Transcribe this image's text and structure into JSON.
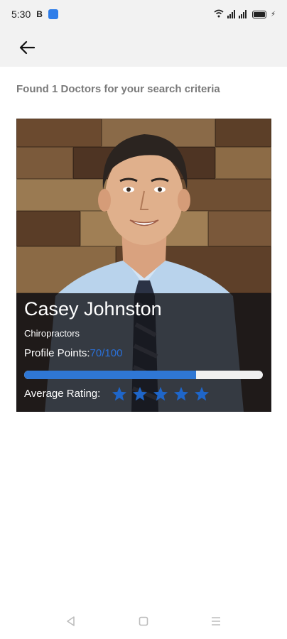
{
  "status_bar": {
    "time": "5:30",
    "carrier_badge": "B",
    "icons": [
      "wifi-icon",
      "signal-icon",
      "signal-icon",
      "battery-icon",
      "charging-icon"
    ]
  },
  "header": {
    "back_icon": "arrow-left-icon"
  },
  "results": {
    "summary": "Found 1 Doctors for your search criteria"
  },
  "doctor_card": {
    "name": "Casey Johnston",
    "specialty": "Chiropractors",
    "profile_points_label": "Profile Points:",
    "profile_points_value": "70/100",
    "profile_points_fraction": 0.72,
    "rating_label": "Average Rating:",
    "rating_stars": 5,
    "star_color": "#1f66c9",
    "accent_color": "#2f77d4"
  },
  "nav_bar": {
    "icons": [
      "back-triangle-icon",
      "home-square-icon",
      "menu-lines-icon"
    ]
  }
}
